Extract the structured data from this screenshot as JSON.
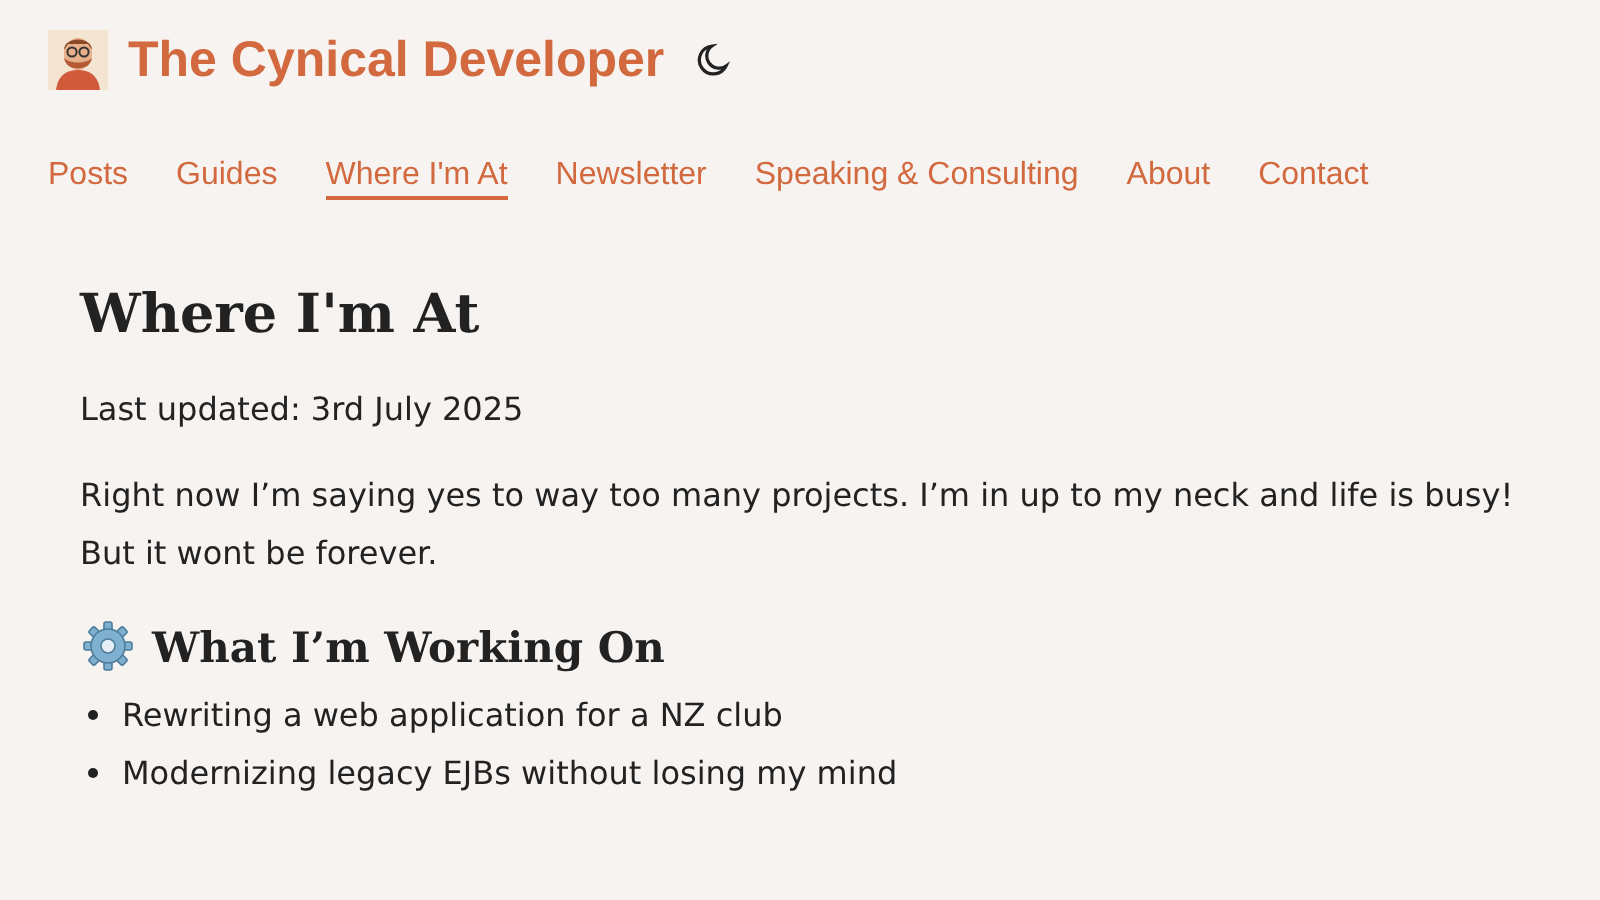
{
  "site": {
    "title": "The Cynical Developer"
  },
  "nav": [
    {
      "label": "Posts",
      "selected": false
    },
    {
      "label": "Guides",
      "selected": false
    },
    {
      "label": "Where I'm At",
      "selected": true
    },
    {
      "label": "Newsletter",
      "selected": false
    },
    {
      "label": "Speaking & Consulting",
      "selected": false
    },
    {
      "label": "About",
      "selected": false
    },
    {
      "label": "Contact",
      "selected": false
    }
  ],
  "page": {
    "title": "Where I'm At",
    "updated": "Last updated: 3rd July 2025",
    "intro": "Right now I’m saying yes to way too many projects. I’m in up to my neck and life is busy! But it wont be forever.",
    "sections": [
      {
        "heading": "What I’m Working On",
        "items": [
          "Rewriting a web application for a NZ club",
          "Modernizing legacy EJBs without losing my mind"
        ]
      }
    ]
  }
}
